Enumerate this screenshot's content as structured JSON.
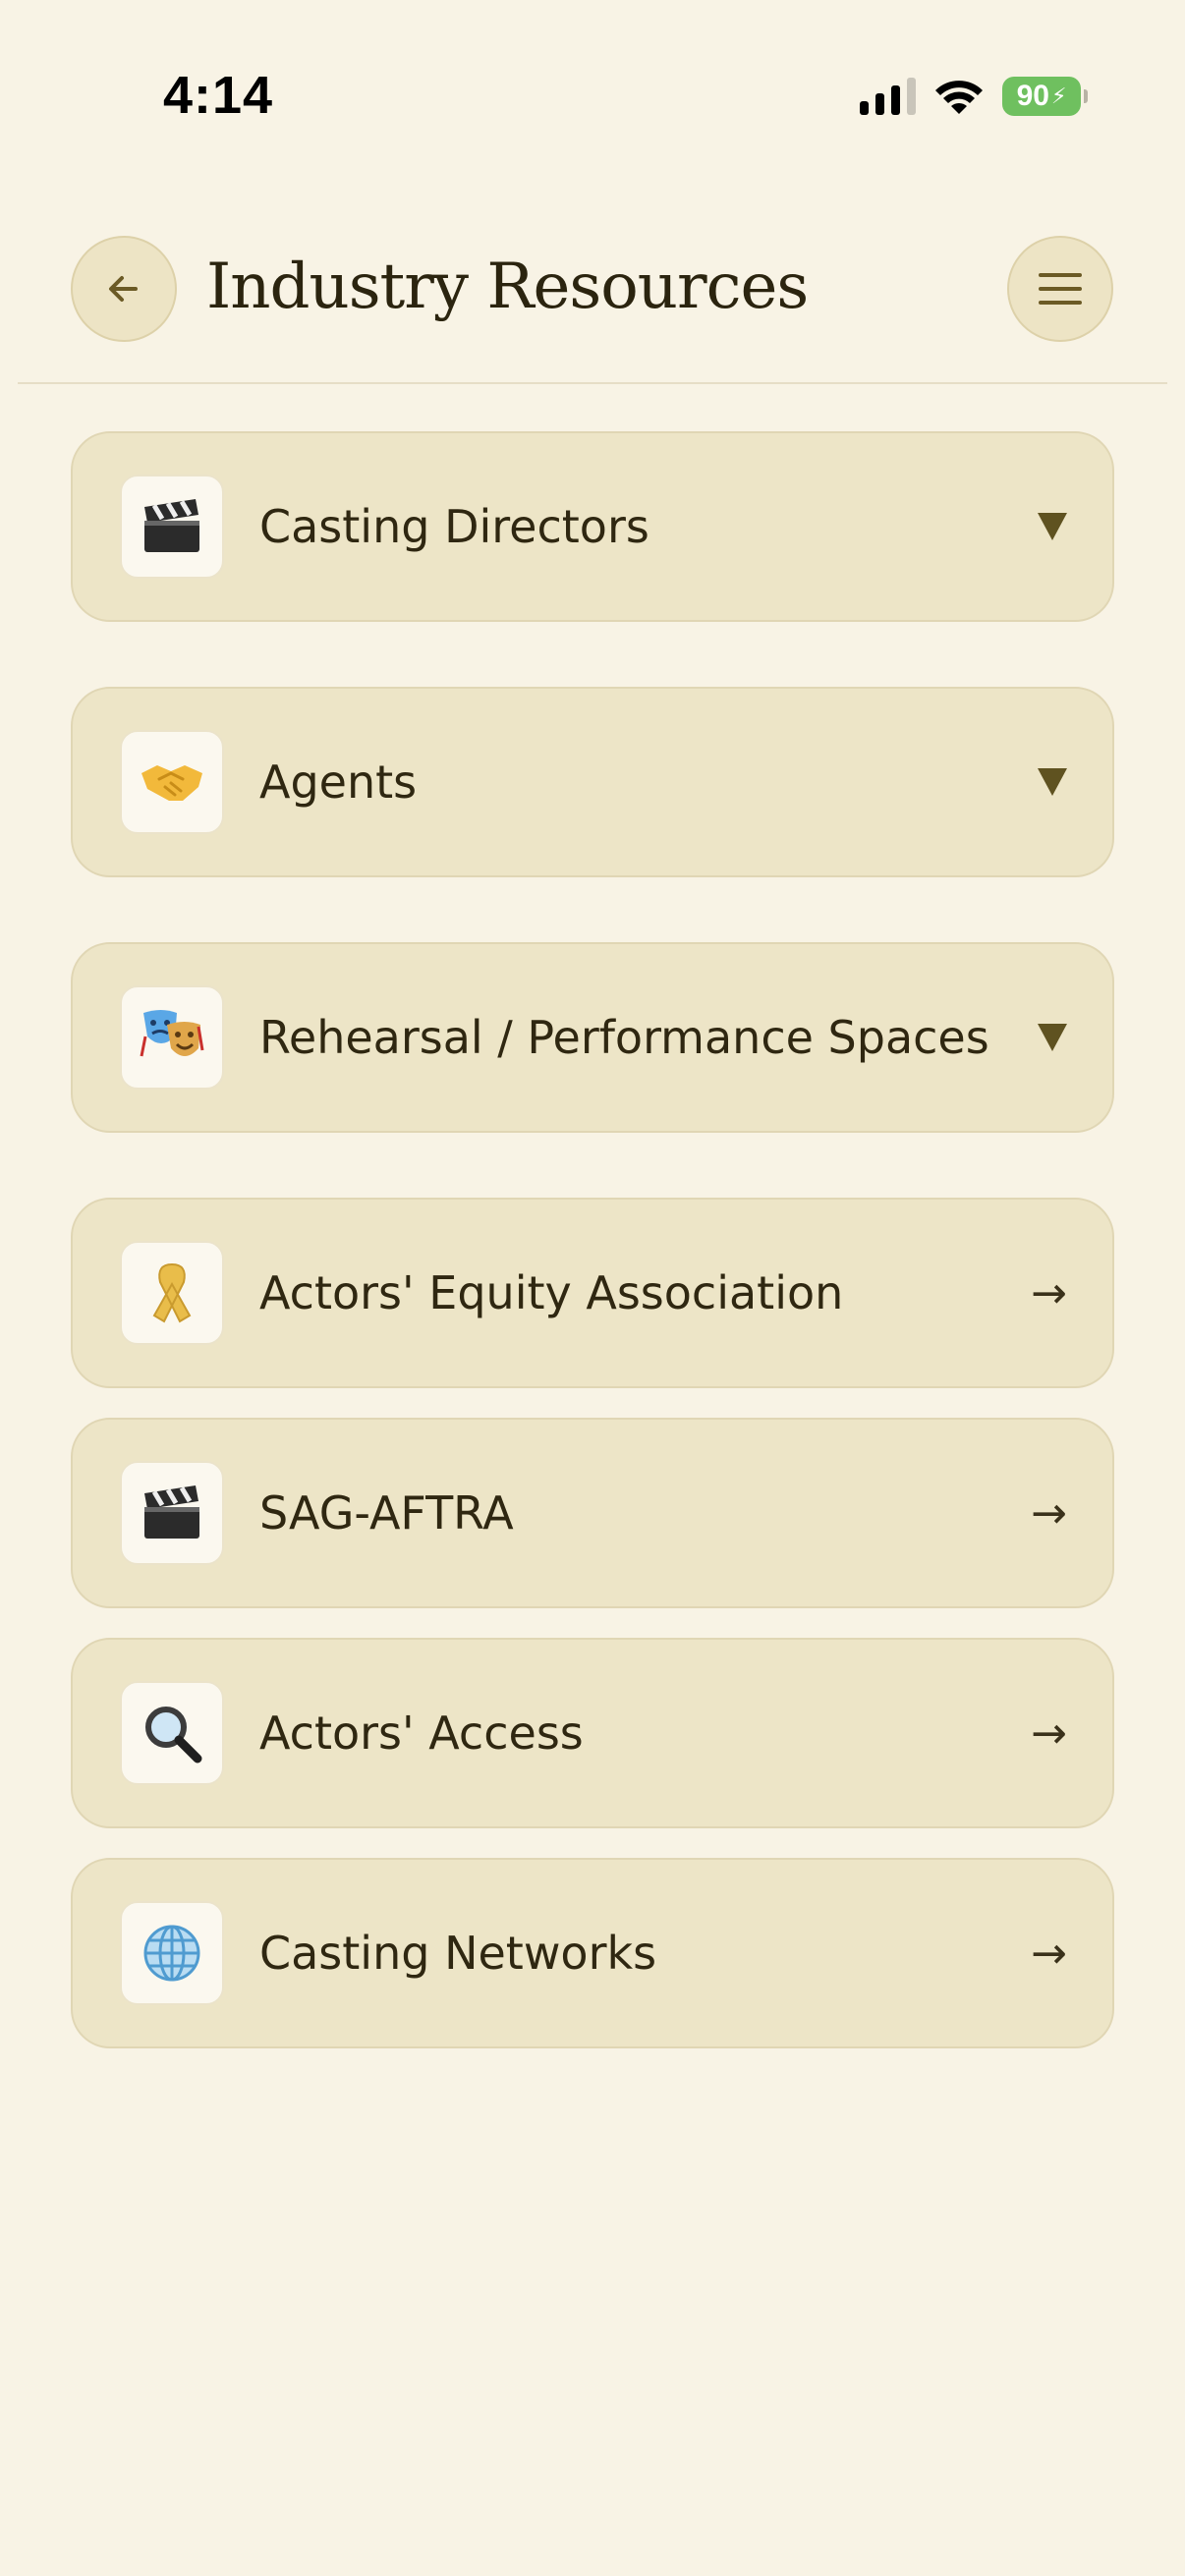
{
  "status_bar": {
    "time": "4:14",
    "battery": "90",
    "battery_color": "#6fc05f"
  },
  "header": {
    "title": "Industry Resources",
    "back_icon": "arrow-left-icon",
    "menu_icon": "hamburger-menu-icon"
  },
  "resources": [
    {
      "label": "Casting Directors",
      "icon": "clapper-board-icon",
      "indicator": "expand-triangle"
    },
    {
      "label": "Agents",
      "icon": "handshake-icon",
      "indicator": "expand-triangle"
    },
    {
      "label": "Rehearsal / Performance Spaces",
      "icon": "theater-masks-icon",
      "indicator": "expand-triangle"
    },
    {
      "label": "Actors' Equity Association",
      "icon": "ribbon-icon",
      "indicator": "arrow-right"
    },
    {
      "label": "SAG-AFTRA",
      "icon": "clapper-board-icon",
      "indicator": "arrow-right"
    },
    {
      "label": "Actors' Access",
      "icon": "magnifying-glass-icon",
      "indicator": "arrow-right"
    },
    {
      "label": "Casting Networks",
      "icon": "globe-icon",
      "indicator": "arrow-right"
    }
  ],
  "colors": {
    "background": "#f8f3e5",
    "card": "#ede5c7",
    "accent": "#6b5a25"
  }
}
